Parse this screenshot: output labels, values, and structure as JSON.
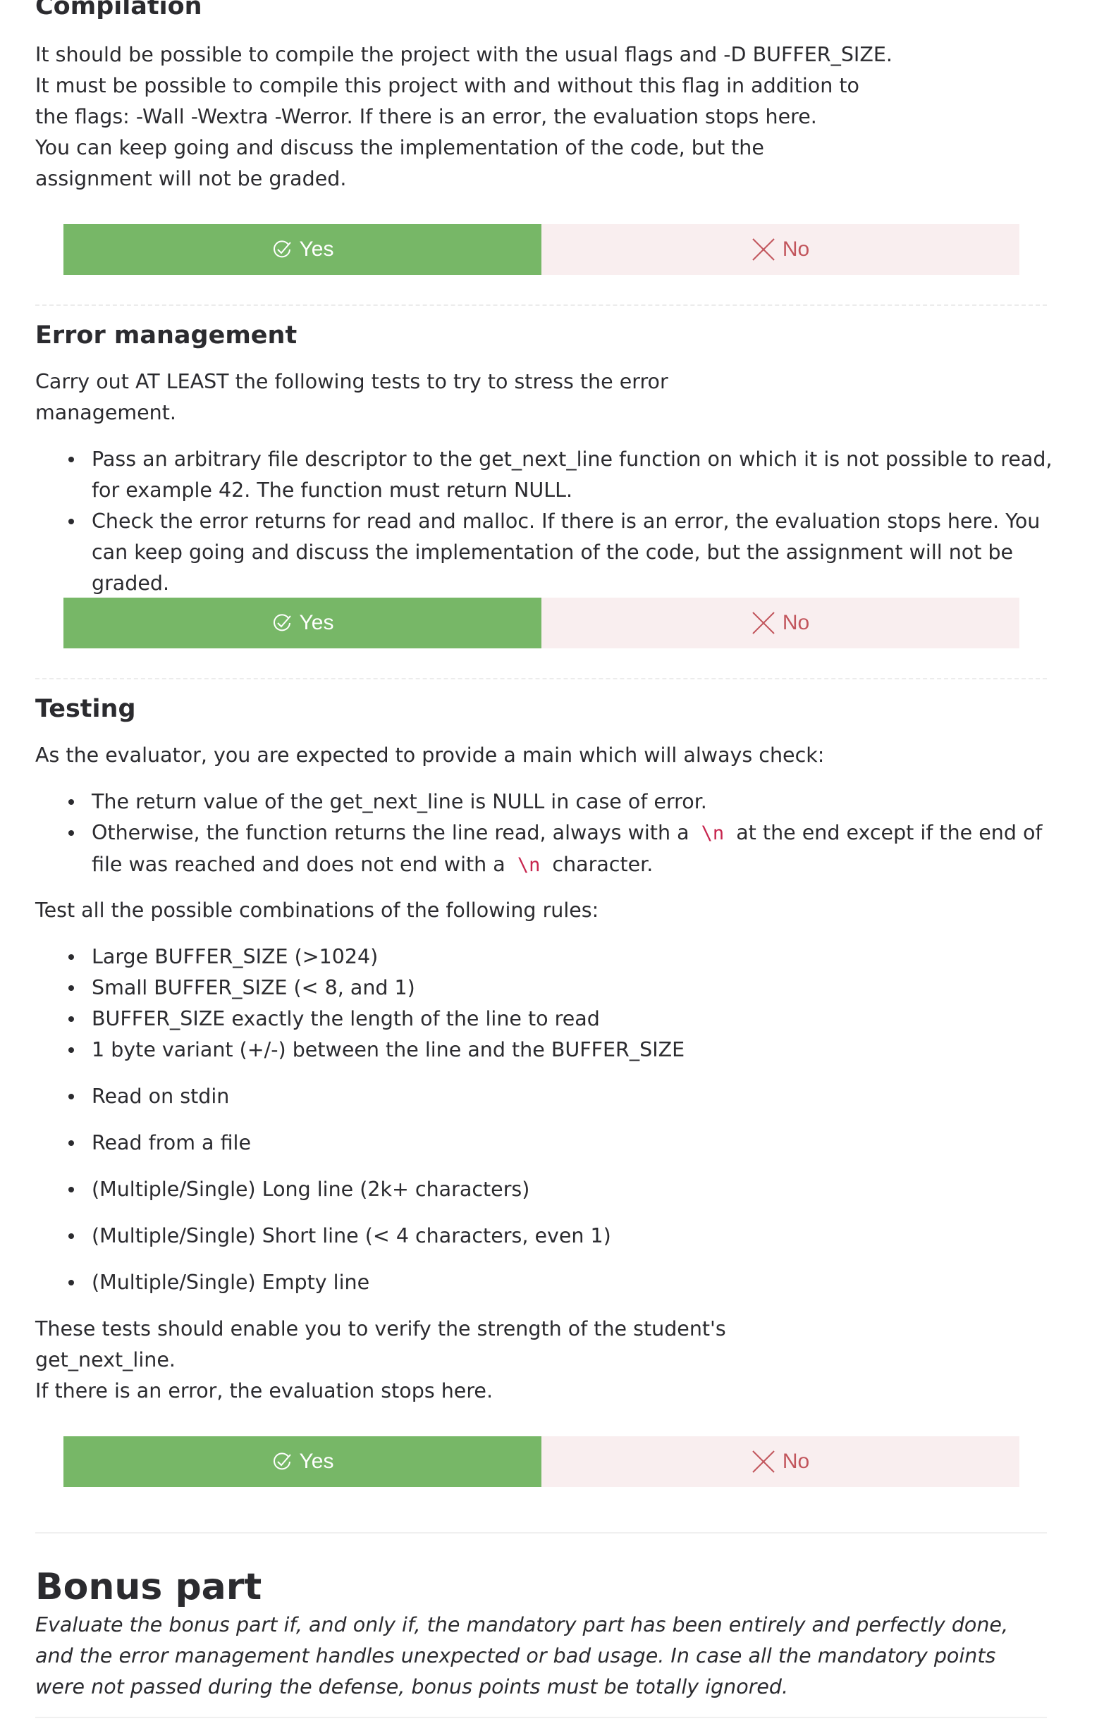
{
  "compilation": {
    "title": "Compilation",
    "lines": [
      "It should be possible to compile the project with the usual flags and -D BUFFER_SIZE.",
      "It must be possible to compile this project with and without this flag in addition to",
      "the flags: -Wall -Wextra -Werror. If there is an error, the evaluation stops here.",
      "You can keep going and discuss the implementation of the code, but the",
      "assignment will not be graded."
    ],
    "yes_label": "Yes",
    "no_label": "No"
  },
  "error_management": {
    "title": "Error management",
    "lines": [
      "Carry out AT LEAST the following tests to try to stress the error",
      "management."
    ],
    "bullets": [
      "Pass an arbitrary file descriptor to the get_next_line function on which it is not possible to read, for example 42. The function must return NULL.",
      "Check the error returns for read and malloc. If there is an error, the evaluation stops here. You can keep going and discuss the implementation of the code, but the assignment will not be graded."
    ],
    "yes_label": "Yes",
    "no_label": "No"
  },
  "testing": {
    "title": "Testing",
    "intro": "As the evaluator, you are expected to provide a main which will always check:",
    "checks": {
      "item1": "The return value of the get_next_line is NULL in case of error.",
      "item2_a": "Otherwise, the function returns the line read, always with a",
      "item2_code1": "\\n",
      "item2_b": "at the end except if the end of file was reached and does not end with a",
      "item2_code2": "\\n",
      "item2_c": "character."
    },
    "combinations_intro": "Test all the possible combinations of the following rules:",
    "buffer_rules": [
      "Large BUFFER_SIZE (>1024)",
      "Small BUFFER_SIZE (< 8, and 1)",
      "BUFFER_SIZE exactly the length of the line to read",
      "1 byte variant (+/-) between the line and the BUFFER_SIZE"
    ],
    "input_rules": [
      "Read on stdin",
      "Read from a file",
      "(Multiple/Single) Long line (2k+ characters)",
      "(Multiple/Single) Short line (< 4 characters, even 1)",
      "(Multiple/Single) Empty line"
    ],
    "closing_lines": [
      "These tests should enable you to verify the strength of the student's",
      "get_next_line.",
      "If there is an error, the evaluation stops here."
    ],
    "yes_label": "Yes",
    "no_label": "No"
  },
  "bonus": {
    "title": "Bonus part",
    "text": "Evaluate the bonus part if, and only if, the mandatory part has been entirely and perfectly done, and the error management handles unexpected or bad usage. In case all the mandatory points were not passed during the defense, bonus points must be totally ignored."
  },
  "colors": {
    "yes_bg": "#77b767",
    "no_bg": "#f9eeef",
    "no_text": "#c2555c",
    "code_text": "#c7254e"
  },
  "icons": {
    "yes": "check-circle-icon",
    "no": "x-icon"
  }
}
